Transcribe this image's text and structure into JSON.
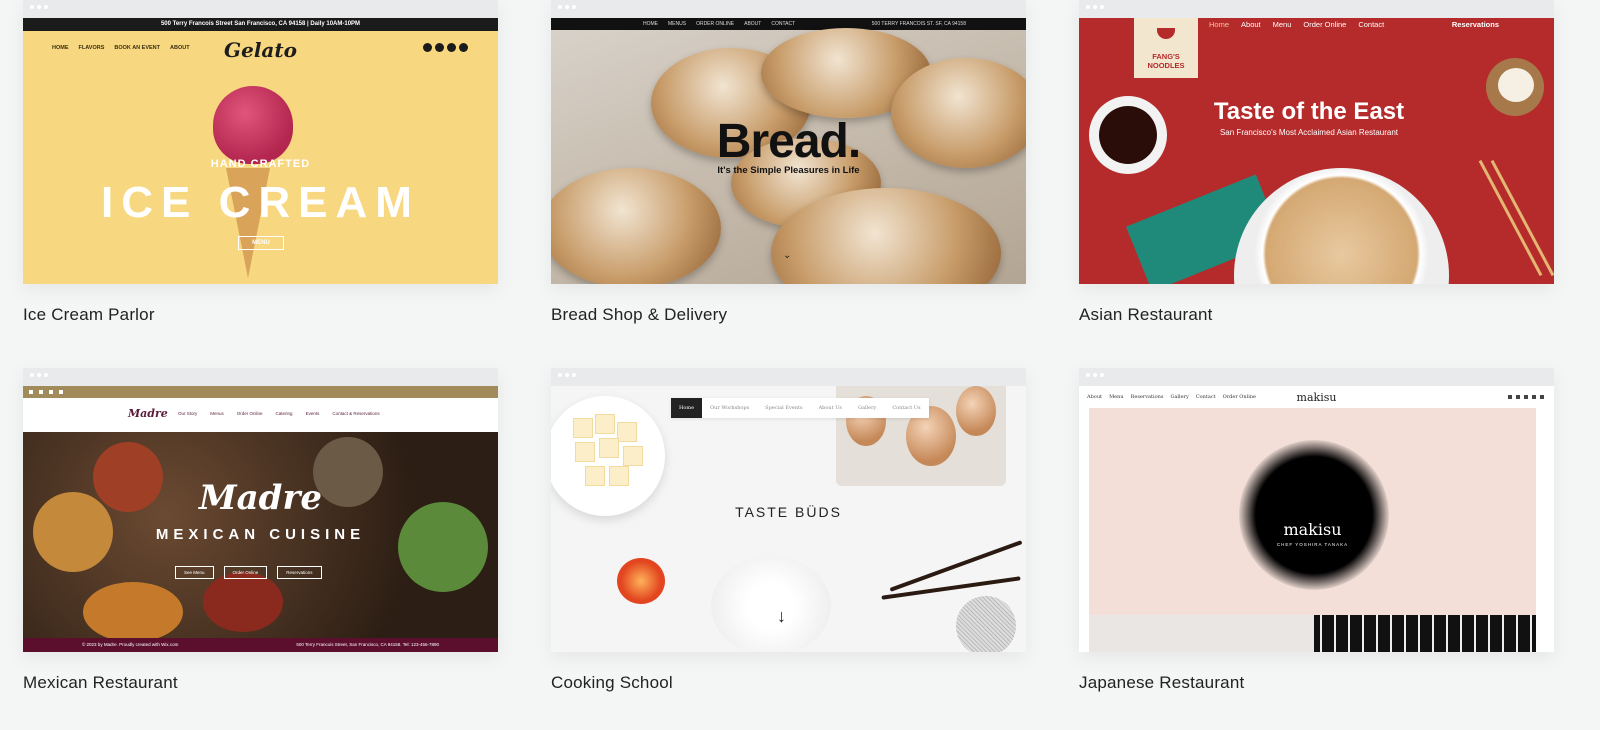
{
  "templates": [
    {
      "label": "Ice Cream Parlor",
      "topbar": "500 Terry Francois Street San Francisco, CA 94158  |  Daily 10AM-10PM",
      "nav": [
        "HOME",
        "FLAVORS",
        "BOOK AN EVENT",
        "ABOUT"
      ],
      "logo": "Gelato",
      "tagline": "HAND CRAFTED",
      "headline": "ICE CREAM",
      "button": "MENU"
    },
    {
      "label": "Bread Shop & Delivery",
      "nav": [
        "HOME",
        "MENUS",
        "ORDER ONLINE",
        "ABOUT",
        "CONTACT"
      ],
      "address": "500 TERRY FRANCOIS  ST. SF, CA 94158",
      "headline": "Bread.",
      "subline": "It's the Simple Pleasures in Life"
    },
    {
      "label": "Asian Restaurant",
      "nav": [
        "Home",
        "About",
        "Menu",
        "Order Online",
        "Contact"
      ],
      "reservations": "Reservations",
      "logo": "FANG'S NOODLES",
      "headline": "Taste of the East",
      "subline": "San Francisco's Most Acclaimed Asian Restaurant"
    },
    {
      "label": "Mexican Restaurant",
      "logo": "Madre",
      "nav": [
        "Our Story",
        "Menus",
        "Order Online",
        "Catering",
        "Events",
        "Contact & Reservations"
      ],
      "headline": "MEXICAN CUISINE",
      "buttons": [
        "See Menu",
        "Order Online",
        "Reservations"
      ],
      "footer_left": "© 2023 by Madre. Proudly created with Wix.com",
      "footer_right": "500 Terry Francois Street, San Francisco, CA 94158. Tel: 123-456-7890"
    },
    {
      "label": "Cooking School",
      "nav": [
        "Home",
        "Our Workshops",
        "Special Events",
        "About Us",
        "Gallery",
        "Contact Us"
      ],
      "headline": "TASTE BÜDS"
    },
    {
      "label": "Japanese Restaurant",
      "nav": [
        "About",
        "Menu",
        "Reservations",
        "Gallery",
        "Contact",
        "Order Online"
      ],
      "logo": "makisu",
      "name": "makisu",
      "chef": "CHEF YOSHIRA TANAKA"
    }
  ]
}
